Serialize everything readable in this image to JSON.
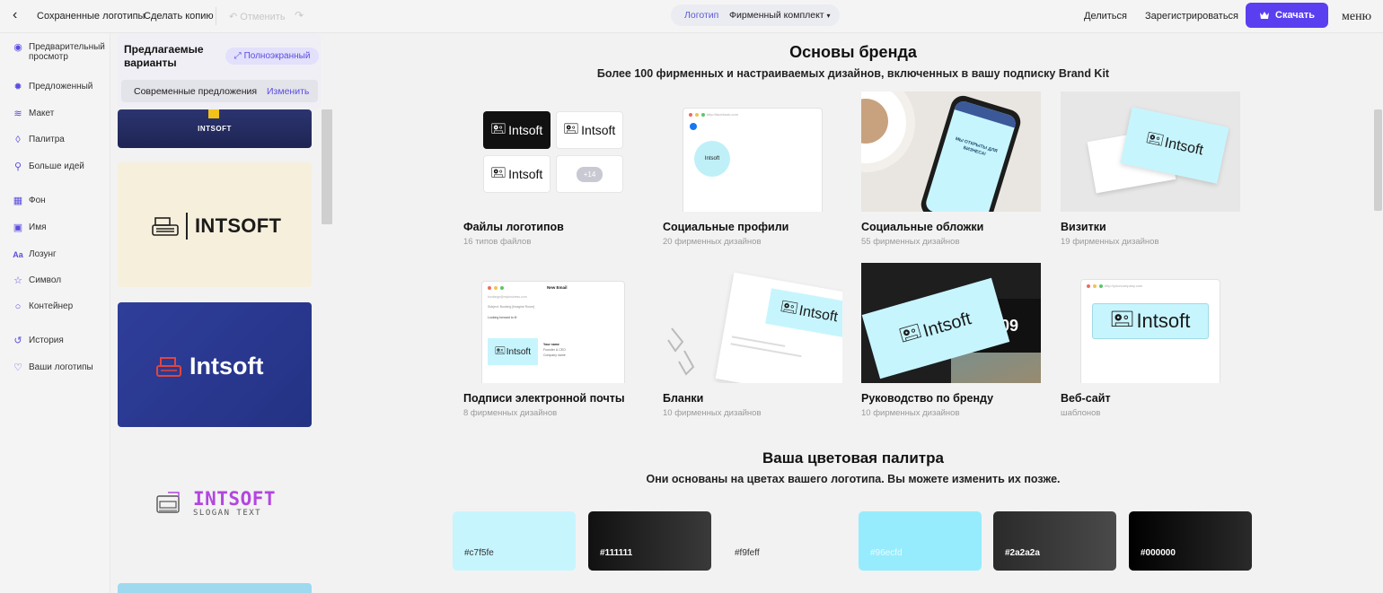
{
  "topbar": {
    "saved_logos": "Сохраненные логотипы",
    "make_copy": "Сделать копию",
    "undo": "Отменить",
    "tab_logo": "Логотип",
    "tab_kit": "Фирменный комплект",
    "share": "Делиться",
    "register": "Зарегистрироваться",
    "download": "Скачать",
    "menu": "меню"
  },
  "leftnav": {
    "items": [
      {
        "label": "Предварительный просмотр",
        "icon": "eye-icon"
      },
      {
        "label": "Предложенный",
        "icon": "bulb-icon"
      },
      {
        "label": "Макет",
        "icon": "layers-icon"
      },
      {
        "label": "Палитра",
        "icon": "drop-icon"
      },
      {
        "label": "Больше идей",
        "icon": "magic-icon"
      },
      {
        "label": "Фон",
        "icon": "grid-icon"
      },
      {
        "label": "Имя",
        "icon": "text-box-icon"
      },
      {
        "label": "Лозунг",
        "icon": "font-icon"
      },
      {
        "label": "Символ",
        "icon": "star-icon"
      },
      {
        "label": "Контейнер",
        "icon": "circle-icon"
      },
      {
        "label": "История",
        "icon": "history-icon"
      },
      {
        "label": "Ваши логотипы",
        "icon": "heart-icon"
      }
    ]
  },
  "panel": {
    "title": "Предлагаемые варианты",
    "fullscreen": "Полноэкранный",
    "modern": "Современные предложения",
    "change": "Изменить",
    "cards": [
      {
        "text": "INTSOFT"
      },
      {
        "text": "INTSOFT"
      },
      {
        "text": "Intsoft"
      },
      {
        "text": "INTSOFT",
        "slogan": "SLOGAN TEXT"
      }
    ]
  },
  "brand": {
    "title": "Основы бренда",
    "subtitle": "Более 100 фирменных и настраиваемых дизайнов, включенных в вашу подписку Brand Kit",
    "logo_word": "Intsoft",
    "plus_count": "+14",
    "social_url": "http://facebook.com",
    "social_promo": "МЫ ОТКРЫТЫ ДЛЯ БИЗНЕСА!",
    "email_title": "New Email",
    "email_lines": [
      "bookings@mybusiness.com",
      "Subject:  Booking [Imagine Room]",
      "Looking forward to it!"
    ],
    "email_sig": [
      "Your name",
      "Founder & CEO",
      "Company name"
    ],
    "guide_number": "09",
    "web_url": "http://yourcompany.com",
    "items": [
      {
        "name": "Файлы логотипов",
        "sub": "16 типов файлов"
      },
      {
        "name": "Социальные профили",
        "sub": "20 фирменных дизайнов"
      },
      {
        "name": "Социальные обложки",
        "sub": "55 фирменных дизайнов"
      },
      {
        "name": "Визитки",
        "sub": "19 фирменных дизайнов"
      },
      {
        "name": "Подписи электронной почты",
        "sub": "8 фирменных дизайнов"
      },
      {
        "name": "Бланки",
        "sub": "10 фирменных дизайнов"
      },
      {
        "name": "Руководство по бренду",
        "sub": "10 фирменных дизайнов"
      },
      {
        "name": "Веб-сайт",
        "sub": "шаблонов"
      }
    ]
  },
  "palette": {
    "title": "Ваша цветовая палитра",
    "subtitle": "Они основаны на цветах вашего логотипа. Вы можете изменить их позже.",
    "colors": [
      {
        "hex": "#c7f5fe",
        "label": "#c7f5fe"
      },
      {
        "hex": "#111111",
        "label": "#111111"
      },
      {
        "hex": "#f9feff",
        "label": "#f9feff"
      },
      {
        "hex": "#96ecfd",
        "label": "#96ecfd"
      },
      {
        "hex": "#2a2a2a",
        "label": "#2a2a2a"
      },
      {
        "hex": "#000000",
        "label": "#000000"
      }
    ]
  }
}
